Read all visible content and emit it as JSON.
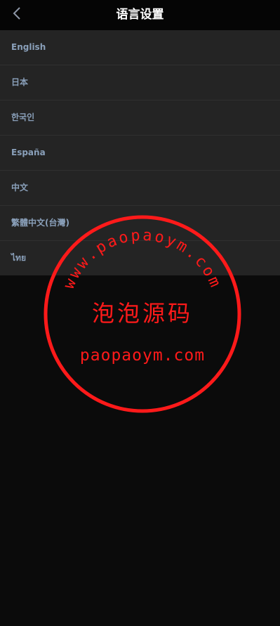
{
  "header": {
    "title": "语言设置",
    "back_icon": "chevron-left-icon"
  },
  "languages": [
    {
      "label": "English"
    },
    {
      "label": "日本"
    },
    {
      "label": "한국인"
    },
    {
      "label": "España"
    },
    {
      "label": "中文"
    },
    {
      "label": "繁體中文(台灣)"
    },
    {
      "label": "ไทย"
    }
  ],
  "watermark": {
    "arc_text": "www.paopaoym.com",
    "center_text": "泡泡源码",
    "bottom_text": "paopaoym.com",
    "color": "#ff1a1a"
  },
  "colors": {
    "background": "#0b0b0b",
    "header": "#050505",
    "list_bg": "#242424",
    "item_text": "#8aa0ba",
    "divider": "#303030"
  }
}
